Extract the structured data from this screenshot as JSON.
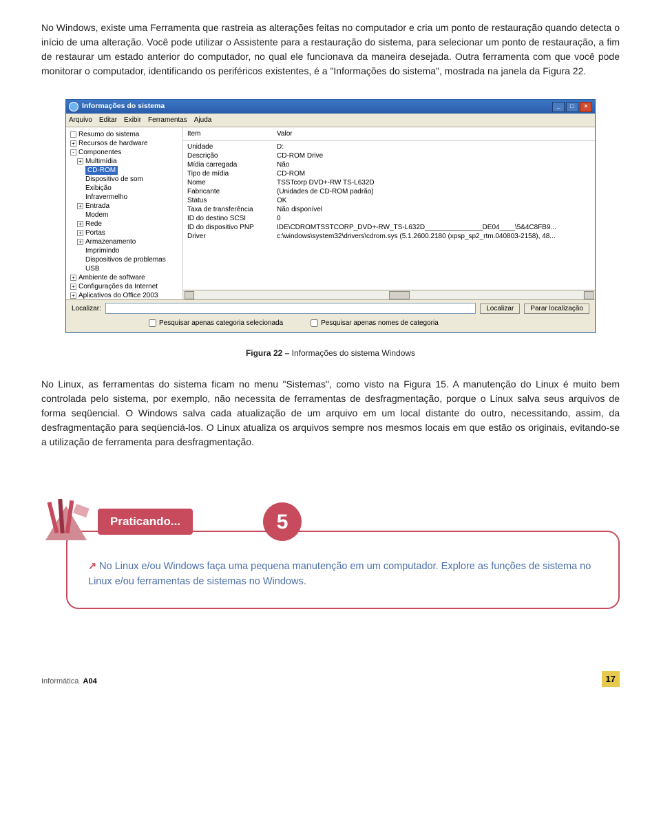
{
  "para1": "No Windows, existe uma Ferramenta que rastreia as alterações feitas no computador e cria um ponto de restauração quando detecta o início de uma alteração. Você pode utilizar o Assistente para a restauração do sistema, para selecionar um ponto de restauração, a fim de restaurar um estado anterior do computador, no qual ele funcionava da maneira desejada. Outra ferramenta com que você pode monitorar o computador, identificando os periféricos existentes, é a \"Informações do sistema\", mostrada na janela da Figura 22.",
  "window": {
    "title": "Informações do sistema",
    "menu": [
      "Arquivo",
      "Editar",
      "Exibir",
      "Ferramentas",
      "Ajuda"
    ],
    "tree": [
      {
        "t": "Resumo do sistema",
        "lvl": 0,
        "box": ""
      },
      {
        "t": "Recursos de hardware",
        "lvl": 0,
        "box": "+"
      },
      {
        "t": "Componentes",
        "lvl": 0,
        "box": "-"
      },
      {
        "t": "Multimídia",
        "lvl": 1,
        "box": "+"
      },
      {
        "t": "CD-ROM",
        "lvl": 2,
        "sel": true
      },
      {
        "t": "Dispositivo de som",
        "lvl": 2
      },
      {
        "t": "Exibição",
        "lvl": 2
      },
      {
        "t": "Infravermelho",
        "lvl": 2
      },
      {
        "t": "Entrada",
        "lvl": 1,
        "box": "+"
      },
      {
        "t": "Modem",
        "lvl": 2
      },
      {
        "t": "Rede",
        "lvl": 1,
        "box": "+"
      },
      {
        "t": "Portas",
        "lvl": 1,
        "box": "+"
      },
      {
        "t": "Armazenamento",
        "lvl": 1,
        "box": "+"
      },
      {
        "t": "Imprimindo",
        "lvl": 2
      },
      {
        "t": "Dispositivos de problemas",
        "lvl": 2
      },
      {
        "t": "USB",
        "lvl": 2
      },
      {
        "t": "Ambiente de software",
        "lvl": 0,
        "box": "+"
      },
      {
        "t": "Configurações da Internet",
        "lvl": 0,
        "box": "+"
      },
      {
        "t": "Aplicativos do Office 2003",
        "lvl": 0,
        "box": "+"
      }
    ],
    "cols": {
      "item": "Item",
      "valor": "Valor"
    },
    "rows": [
      {
        "k": "Unidade",
        "v": "D:"
      },
      {
        "k": "Descrição",
        "v": "CD-ROM Drive"
      },
      {
        "k": "Mídia carregada",
        "v": "Não"
      },
      {
        "k": "Tipo de mídia",
        "v": "CD-ROM"
      },
      {
        "k": "Nome",
        "v": "TSSTcorp DVD+-RW TS-L632D"
      },
      {
        "k": "Fabricante",
        "v": "(Unidades de CD-ROM padrão)"
      },
      {
        "k": "Status",
        "v": "OK"
      },
      {
        "k": "Taxa de transferência",
        "v": "Não disponível"
      },
      {
        "k": "ID do destino SCSI",
        "v": "0"
      },
      {
        "k": "ID do dispositivo PNP",
        "v": "IDE\\CDROMTSSTCORP_DVD+-RW_TS-L632D_______________DE04____\\5&4C8FB9..."
      },
      {
        "k": "Driver",
        "v": "c:\\windows\\system32\\drivers\\cdrom.sys (5.1.2600.2180 (xpsp_sp2_rtm.040803-2158), 48..."
      }
    ],
    "search": {
      "label": "Localizar:",
      "btn1": "Localizar",
      "btn2": "Parar localização",
      "chk1": "Pesquisar apenas categoria selecionada",
      "chk2": "Pesquisar apenas nomes de categoria"
    }
  },
  "caption": {
    "bold": "Figura 22 –",
    "rest": " Informações do sistema Windows"
  },
  "para2": "No Linux, as ferramentas do sistema ficam no menu \"Sistemas\", como visto na Figura 15. A manutenção do Linux é muito bem controlada pelo sistema, por exemplo, não necessita de ferramentas de desfragmentação, porque o Linux salva seus arquivos de forma seqüencial. O Windows salva cada atualização de um arquivo em um local distante do outro, necessitando, assim, da desfragmentação para seqüenciá-los. O Linux atualiza os arquivos sempre nos mesmos locais em que estão os originais, evitando-se a utilização de ferramenta para desfragmentação.",
  "praticando": {
    "label": "Praticando...",
    "num": "5",
    "text": "No Linux e/ou Windows faça uma pequena manutenção em um computador. Explore as funções de sistema no Linux e/ou ferramentas de sistemas no Windows."
  },
  "footer": {
    "module": "Informática",
    "code": "A04",
    "page": "17"
  }
}
